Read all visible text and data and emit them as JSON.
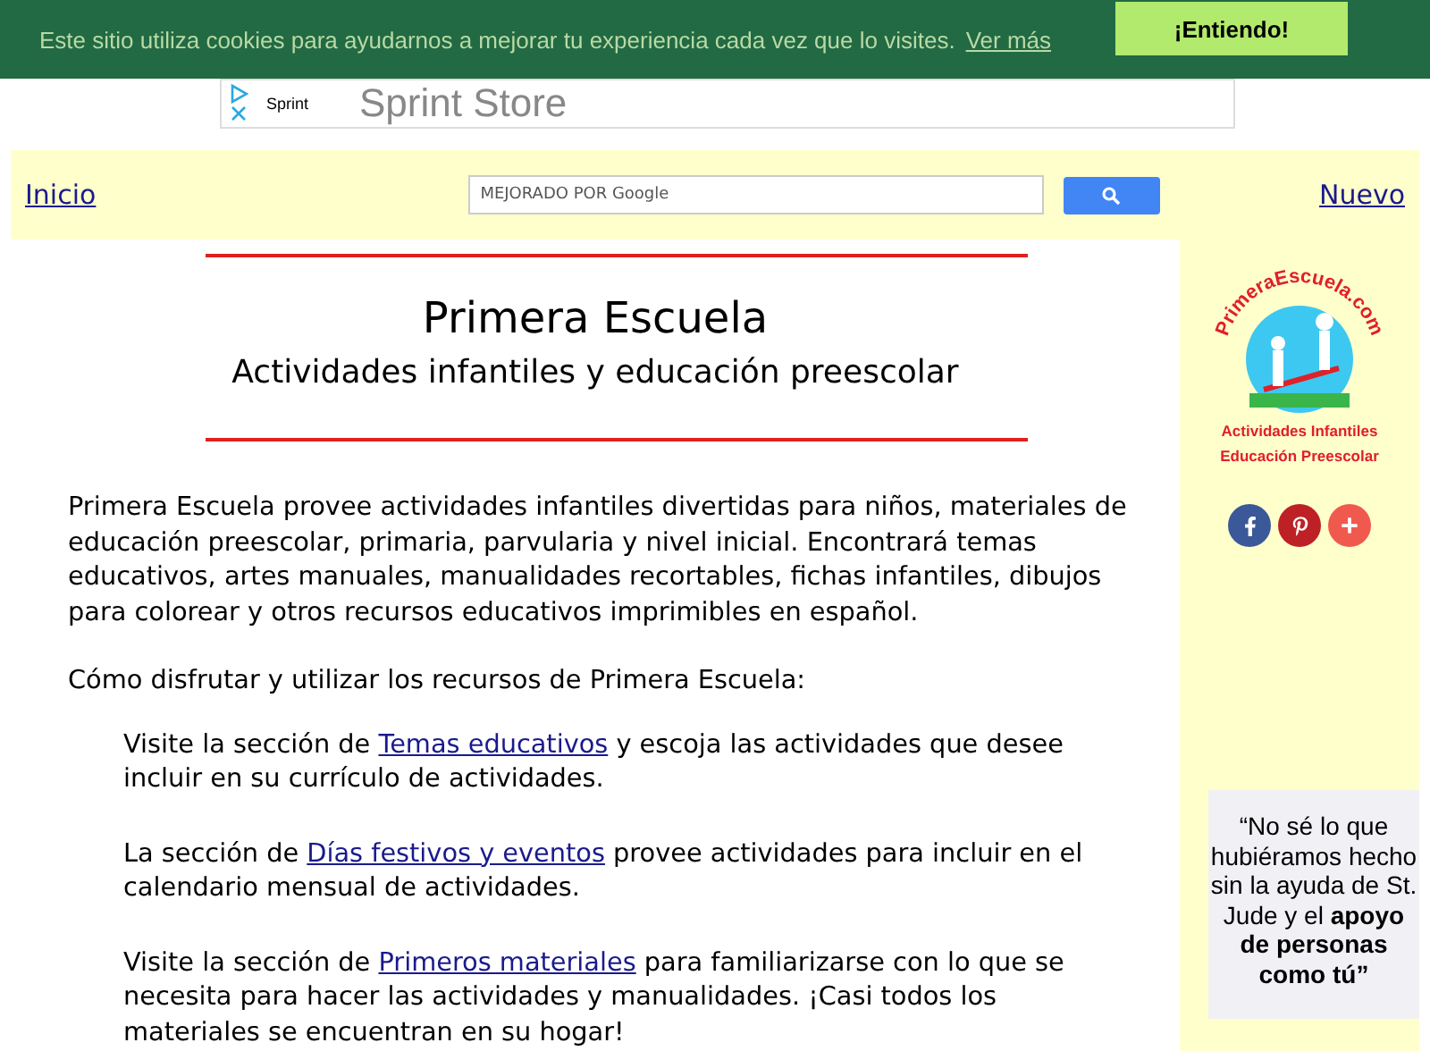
{
  "cookie_bar": {
    "message": "Este sitio utiliza cookies para ayudarnos a mejorar tu experiencia cada vez que lo visites.",
    "link": "Ver más",
    "button": "¡Entiendo!"
  },
  "ad_banner": {
    "advertiser": "Sprint",
    "headline": "Sprint Store"
  },
  "header": {
    "home_link": "Inicio",
    "search": {
      "placeholder": "MEJORADO POR Google"
    },
    "new_link": "Nuevo"
  },
  "main": {
    "title": "Primera Escuela",
    "subtitle": "Actividades infantiles y educación preescolar",
    "intro": "Primera Escuela provee actividades infantiles divertidas para niños, materiales de educación preescolar, primaria, parvularia y nivel inicial. Encontrará temas educativos, artes manuales, manualidades recortables, fichas infantiles, dibujos para colorear y otros recursos educativos imprimibles en español.",
    "lead": "Cómo disfrutar y utilizar los recursos de Primera Escuela:",
    "items": [
      {
        "before": "Visite la sección de",
        "link": "Temas educativos",
        "after": "y escoja las actividades que desee incluir en su currículo de actividades."
      },
      {
        "before": "La sección de",
        "link": "Días festivos y eventos",
        "after": "provee actividades para incluir en el calendario mensual de actividades."
      },
      {
        "before": "Visite la sección de",
        "link": "Primeros materiales",
        "after": "para familiarizarse con lo que se necesita para hacer las actividades y manualidades. ¡Casi todos los materiales se encuentran en su hogar!"
      }
    ]
  },
  "sidebar": {
    "logo": {
      "top": "PrimeraEscuela.com",
      "middle": "Actividades Infantiles",
      "bottom": "Educación Preescolar"
    },
    "share_buttons": [
      {
        "kind": "facebook"
      },
      {
        "kind": "pinterest"
      },
      {
        "kind": "more"
      }
    ],
    "ad": {
      "text": "“No sé lo que hubiéramos hecho sin la ayuda de St. Jude y el **apoyo de personas como tú”**"
    }
  }
}
